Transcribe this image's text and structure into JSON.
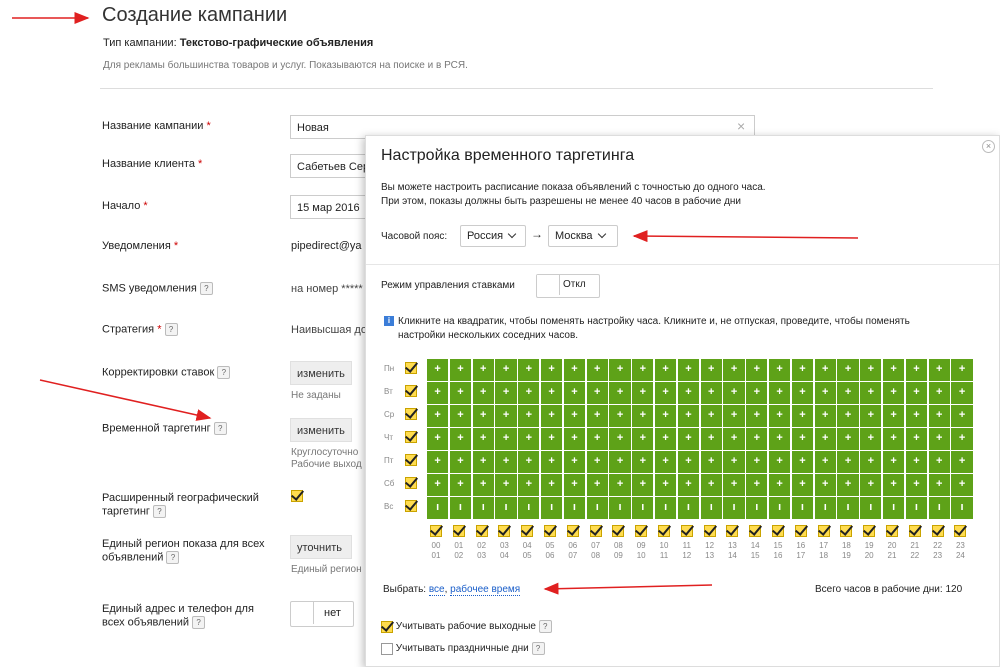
{
  "page": {
    "title": "Создание кампании",
    "type_label": "Тип кампании:",
    "type_value": "Текстово-графические объявления",
    "description": "Для рекламы большинства товаров и услуг. Показываются на поиске и в РСЯ."
  },
  "form": {
    "campaign_name": {
      "label": "Название кампании",
      "value": "Новая"
    },
    "client_name": {
      "label": "Название клиента",
      "value": "Сабетьев Сер"
    },
    "start": {
      "label": "Начало",
      "value": "15 мар 2016"
    },
    "notifications": {
      "label": "Уведомления",
      "value": "pipedirect@ya"
    },
    "sms": {
      "label": "SMS уведомления",
      "value": "на номер *****"
    },
    "strategy": {
      "label": "Стратегия",
      "value": "Наивысшая до"
    },
    "bid_adjust": {
      "label": "Корректировки ставок",
      "button": "изменить",
      "note": "Не заданы"
    },
    "time_targeting": {
      "label": "Временной таргетинг",
      "button": "изменить",
      "note1": "Круглосуточно",
      "note2": "Рабочие выход"
    },
    "geo": {
      "label1": "Расширенный географический",
      "label2": "таргетинг"
    },
    "region": {
      "label1": "Единый регион показа для всех",
      "label2": "объявлений",
      "button": "уточнить",
      "note": "Единый регион"
    },
    "contacts": {
      "label1": "Единый адрес и телефон для",
      "label2": "всех объявлений",
      "toggle": "нет"
    }
  },
  "modal": {
    "title": "Настройка временного таргетинга",
    "close": "×",
    "intro1": "Вы можете настроить расписание показа объявлений с точностью до одного часа.",
    "intro2": "При этом, показы должны быть разрешены не менее 40 часов в рабочие дни",
    "tz_label": "Часовой пояс:",
    "tz_country": "Россия",
    "tz_arrow": "→",
    "tz_city": "Москва",
    "bid_mode_label": "Режим управления ставками",
    "bid_mode_toggle": "Откл",
    "hint1": "Кликните на квадратик, чтобы поменять настройку часа. Кликните и, не отпуская, проведите, чтобы поменять",
    "hint2": "настройки нескольких соседних часов.",
    "days": [
      "Пн",
      "Вт",
      "Ср",
      "Чт",
      "Пт",
      "Сб",
      "Вс"
    ],
    "hours_top": [
      "00",
      "01",
      "02",
      "03",
      "04",
      "05",
      "06",
      "07",
      "08",
      "09",
      "10",
      "11",
      "12",
      "13",
      "14",
      "15",
      "16",
      "17",
      "18",
      "19",
      "20",
      "21",
      "22",
      "23"
    ],
    "hours_bottom": [
      "01",
      "02",
      "03",
      "04",
      "05",
      "06",
      "07",
      "08",
      "09",
      "10",
      "11",
      "12",
      "13",
      "14",
      "15",
      "16",
      "17",
      "18",
      "19",
      "20",
      "21",
      "22",
      "23",
      "24"
    ],
    "cell_on": "+",
    "cell_off": "ı",
    "select_label": "Выбрать:",
    "select_all": "все",
    "select_work": "рабочее время",
    "total_label": "Всего часов в рабочие дни:",
    "total_value": "120",
    "weekend_label": "Учитывать рабочие выходные",
    "holiday_label": "Учитывать праздничные дни"
  },
  "colors": {
    "grid_green": "#5ea218",
    "arrow_red": "#e02020"
  }
}
